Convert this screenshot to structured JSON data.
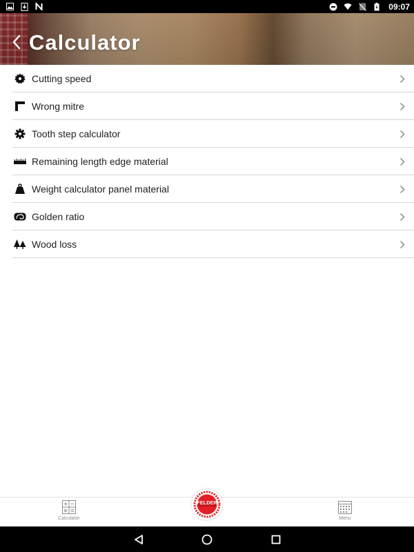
{
  "status_bar": {
    "time": "09:07",
    "left_icons": [
      "image-icon",
      "download-icon",
      "n-icon"
    ],
    "right_icons": [
      "dnd-icon",
      "wifi-icon",
      "no-sim-icon",
      "battery-charging-icon"
    ]
  },
  "header": {
    "title": "Calculator",
    "back_icon": "chevron-left-icon"
  },
  "calculators": [
    {
      "label": "Cutting speed",
      "icon": "saw-blade-icon"
    },
    {
      "label": "Wrong mitre",
      "icon": "mitre-angle-icon"
    },
    {
      "label": "Tooth step calculator",
      "icon": "gear-icon"
    },
    {
      "label": "Remaining length edge material",
      "icon": "ruler-icon"
    },
    {
      "label": "Weight calculator panel material",
      "icon": "weight-icon"
    },
    {
      "label": "Golden ratio",
      "icon": "golden-spiral-icon"
    },
    {
      "label": "Wood loss",
      "icon": "trees-icon"
    }
  ],
  "bottom_nav": {
    "calculator_label": "Calculator",
    "menu_label": "Menu",
    "logo_text": "FELDER"
  },
  "colors": {
    "accent": "#e31e24",
    "text": "#1f1f1f",
    "divider": "#d6d6d6",
    "tab_label": "#8a8a8a"
  }
}
